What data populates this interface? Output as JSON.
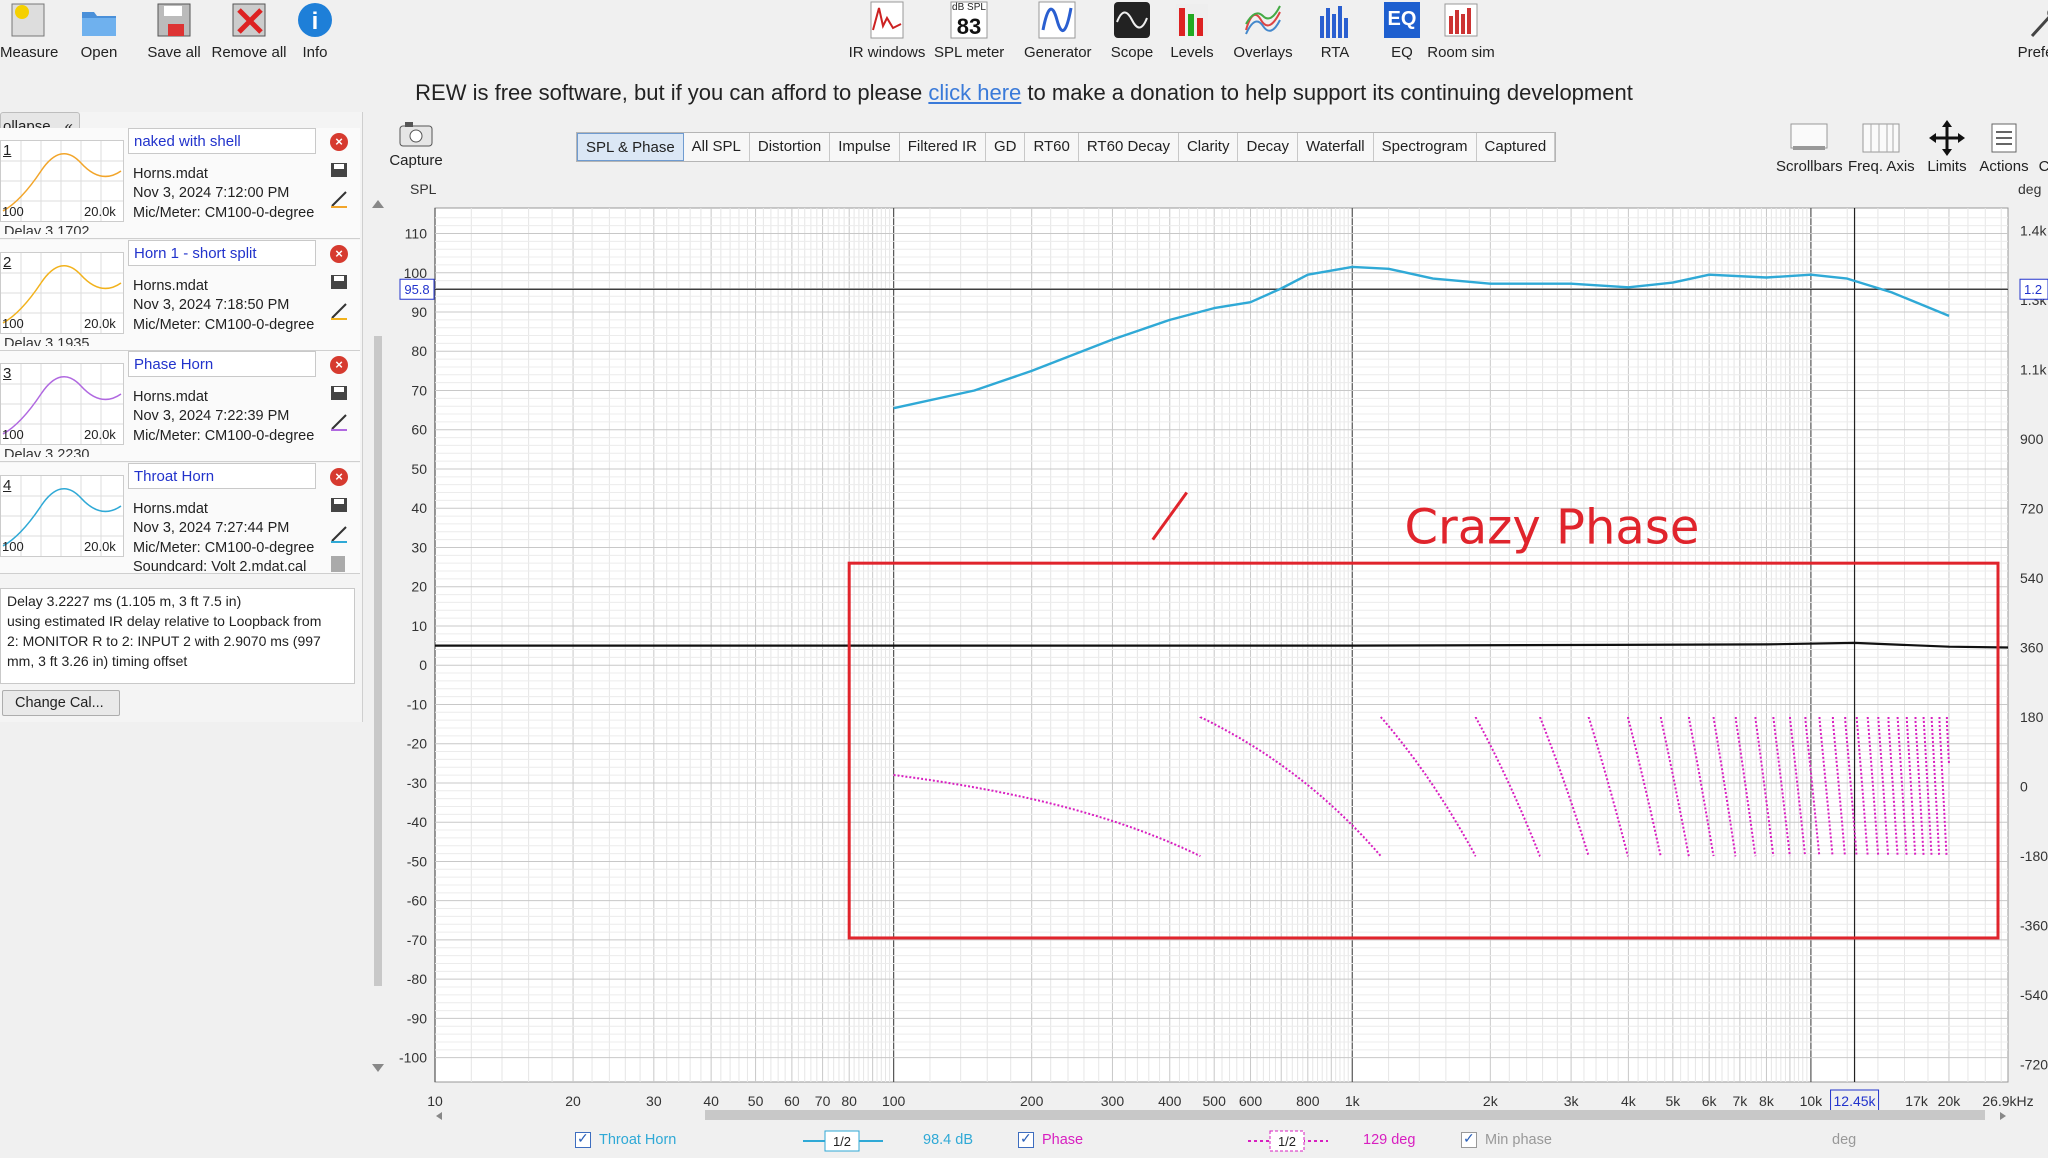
{
  "toolbar_left": [
    {
      "label": "Measure",
      "icon": "measure-icon"
    },
    {
      "label": "Open",
      "icon": "folder-icon"
    },
    {
      "label": "Save all",
      "icon": "save-icon"
    },
    {
      "label": "Remove all",
      "icon": "remove-all-icon"
    },
    {
      "label": "Info",
      "icon": "info-icon"
    }
  ],
  "toolbar_center": [
    {
      "label": "IR windows",
      "icon": "ir-windows-icon"
    },
    {
      "label": "SPL meter",
      "icon": "spl-meter-icon",
      "badge_top": "dB SPL",
      "badge_value": "83"
    },
    {
      "label": "Generator",
      "icon": "generator-icon"
    },
    {
      "label": "Scope",
      "icon": "scope-icon"
    },
    {
      "label": "Levels",
      "icon": "levels-icon"
    },
    {
      "label": "Overlays",
      "icon": "overlays-icon"
    },
    {
      "label": "RTA",
      "icon": "rta-icon"
    },
    {
      "label": "EQ",
      "icon": "eq-icon",
      "badge_value": "EQ"
    },
    {
      "label": "Room sim",
      "icon": "room-sim-icon"
    }
  ],
  "toolbar_right": {
    "label": "Prefer"
  },
  "banner": {
    "before": "REW is free software, but if you can afford to please",
    "link": "click here",
    "after": "to make a donation to help support its continuing development"
  },
  "left_panel": {
    "collapse_label": "ollapse",
    "collapse_icon": "double-chevron-left-icon",
    "measurements": [
      {
        "num": "1",
        "name": "naked with shell",
        "file": "Horns.mdat",
        "date": "Nov 3, 2024 7:12:00 PM",
        "mic": "Mic/Meter: CM100-0-degree",
        "delay_snip": "Delay 3.1702",
        "t100": "100",
        "t20k": "20.0k",
        "color": "#f2a52a"
      },
      {
        "num": "2",
        "name": "Horn 1 - short split",
        "file": "Horns.mdat",
        "date": "Nov 3, 2024 7:18:50 PM",
        "mic": "Mic/Meter: CM100-0-degree",
        "delay_snip": "Delay 3.1935",
        "t100": "100",
        "t20k": "20.0k",
        "color": "#f2b21c"
      },
      {
        "num": "3",
        "name": "Phase Horn",
        "file": "Horns.mdat",
        "date": "Nov 3, 2024 7:22:39 PM",
        "mic": "Mic/Meter: CM100-0-degree",
        "delay_snip": "Delay 3.2230",
        "t100": "100",
        "t20k": "20.0k",
        "color": "#b068e0"
      },
      {
        "num": "4",
        "name": "Throat Horn",
        "file": "Horns.mdat",
        "date": "Nov 3, 2024 7:27:44 PM",
        "mic": "Mic/Meter: CM100-0-degree",
        "soundcard": "Soundcard: Volt 2.mdat.cal",
        "t100": "100",
        "t20k": "20.0k",
        "color": "#2fa9d6"
      }
    ],
    "info_lines": [
      "Delay 3.2227 ms (1.105 m, 3 ft 7.5 in)",
      "using estimated IR delay relative to Loopback from",
      "2: MONITOR R to 2: INPUT 2 with 2.9070 ms (997",
      "mm, 3 ft 3.26 in) timing offset"
    ],
    "change_cal": "Change Cal..."
  },
  "capture": {
    "label": "Capture",
    "icon": "camera-icon"
  },
  "tabs": [
    "SPL & Phase",
    "All SPL",
    "Distortion",
    "Impulse",
    "Filtered IR",
    "GD",
    "RT60",
    "RT60 Decay",
    "Clarity",
    "Decay",
    "Waterfall",
    "Spectrogram",
    "Captured"
  ],
  "active_tab": "SPL & Phase",
  "right_tools": [
    {
      "label": "Scrollbars",
      "icon": "scrollbars-icon"
    },
    {
      "label": "Freq. Axis",
      "icon": "freq-axis-icon"
    },
    {
      "label": "Limits",
      "icon": "limits-icon"
    },
    {
      "label": "Actions",
      "icon": "actions-icon"
    },
    {
      "label": "C",
      "icon": ""
    }
  ],
  "cursor_readouts": {
    "spl": "95.8",
    "phase": "1.2",
    "freq": "12.45k"
  },
  "annotation": {
    "text": "Crazy Phase",
    "color": "#e0242c"
  },
  "legend": {
    "series1": {
      "name": "Throat Horn",
      "smoothing": "1/2",
      "value": "98.4 dB",
      "color": "#2fa9d6"
    },
    "series2": {
      "name": "Phase",
      "smoothing": "1/2",
      "value": "129 deg",
      "color": "#d81fc0"
    },
    "series3": {
      "name": "Min phase",
      "unit": "deg"
    }
  },
  "chart_data": {
    "type": "line",
    "ylabel": "SPL",
    "y2label": "deg",
    "xscale": "log",
    "xlim": [
      10,
      26900
    ],
    "ylim": [
      -100,
      110
    ],
    "y2lim": [
      -720,
      1440
    ],
    "x_tick_labels": [
      "10",
      "20",
      "30",
      "40",
      "50",
      "60",
      "70",
      "80",
      "100",
      "200",
      "300",
      "400",
      "500",
      "600",
      "800",
      "1k",
      "2k",
      "3k",
      "4k",
      "5k",
      "6k",
      "7k",
      "8k",
      "10k",
      "12.45k",
      "17k",
      "20k",
      "26.9kHz"
    ],
    "x_tick_values": [
      10,
      20,
      30,
      40,
      50,
      60,
      70,
      80,
      100,
      200,
      300,
      400,
      500,
      600,
      800,
      1000,
      2000,
      3000,
      4000,
      5000,
      6000,
      7000,
      8000,
      10000,
      12450,
      17000,
      20000,
      26900
    ],
    "y_tick_labels": [
      "110",
      "100",
      "90",
      "80",
      "70",
      "60",
      "50",
      "40",
      "30",
      "20",
      "10",
      "0",
      "-10",
      "-20",
      "-30",
      "-40",
      "-50",
      "-60",
      "-70",
      "-80",
      "-90",
      "-100"
    ],
    "y_tick_values": [
      110,
      100,
      90,
      80,
      70,
      60,
      50,
      40,
      30,
      20,
      10,
      0,
      -10,
      -20,
      -30,
      -40,
      -50,
      -60,
      -70,
      -80,
      -90,
      -100
    ],
    "y2_tick_labels": [
      "1.4k",
      "1.3k",
      "1.1k",
      "900",
      "720",
      "540",
      "360",
      "180",
      "0",
      "-180",
      "-360",
      "-540",
      "-720"
    ],
    "y2_tick_values": [
      1440,
      1260,
      1080,
      900,
      720,
      540,
      360,
      180,
      0,
      -180,
      -360,
      -540,
      -720
    ],
    "grid": true,
    "series": [
      {
        "name": "Throat Horn",
        "color": "#2fa9d6",
        "x": [
          100,
          150,
          200,
          300,
          400,
          500,
          600,
          700,
          800,
          1000,
          1200,
          1500,
          2000,
          3000,
          4000,
          5000,
          6000,
          8000,
          10000,
          12000,
          15000,
          20000
        ],
        "y": [
          65.5,
          70,
          75,
          83,
          88,
          91,
          92.5,
          96,
          99.5,
          101.5,
          101,
          98.5,
          97.2,
          97.2,
          96.3,
          97.5,
          99.5,
          98.8,
          99.5,
          98.5,
          95,
          89
        ]
      },
      {
        "name": "Phase",
        "color": "#d81fc0",
        "y_axis": "right",
        "x": [
          100,
          200,
          280,
          290,
          400,
          550,
          560,
          700,
          850
        ],
        "y": [
          30,
          -110,
          -180,
          180,
          -50,
          -180,
          180,
          20,
          -180
        ]
      },
      {
        "name": "",
        "color": "#111111",
        "y_axis": "right",
        "x": [
          10,
          100,
          1000,
          8000,
          12450,
          20000,
          26900
        ],
        "y": [
          365,
          365,
          365,
          368,
          372,
          362,
          360
        ]
      }
    ]
  }
}
